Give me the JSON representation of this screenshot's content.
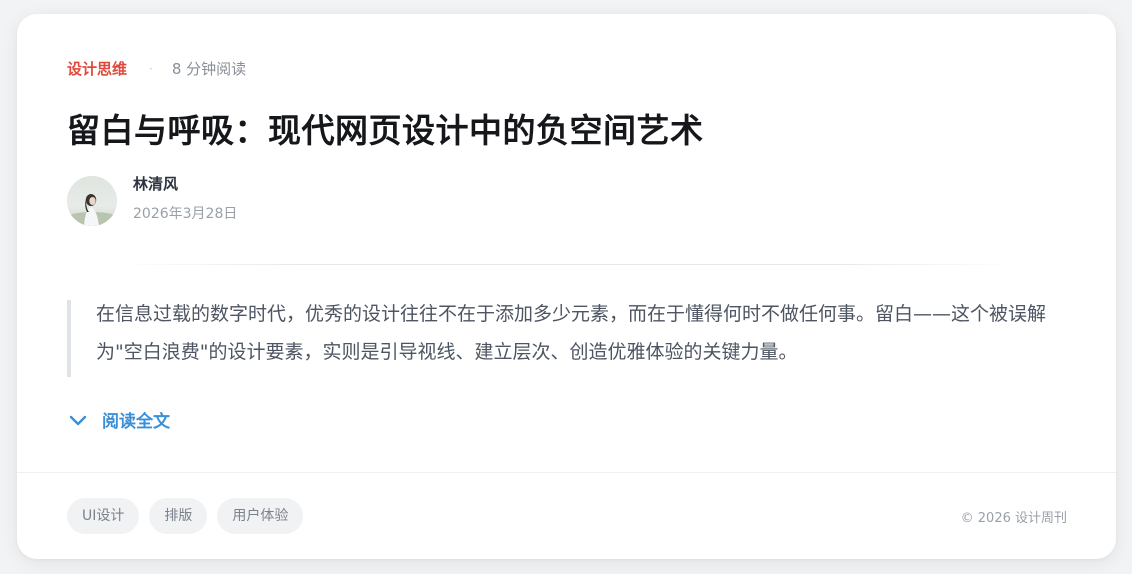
{
  "article": {
    "category": "设计思维",
    "separator": "·",
    "read_time": "8 分钟阅读",
    "title": "留白与呼吸：现代网页设计中的负空间艺术",
    "author": {
      "name": "林清风",
      "date": "2026年3月28日",
      "avatar_icon": "avatar-photo"
    },
    "excerpt": "在信息过载的数字时代，优秀的设计往往不在于添加多少元素，而在于懂得何时不做任何事。留白——这个被误解为\"空白浪费\"的设计要素，实则是引导视线、建立层次、创造优雅体验的关键力量。",
    "read_more": {
      "label": "阅读全文",
      "icon": "chevron-down-icon"
    }
  },
  "footer": {
    "tags": [
      "UI设计",
      "排版",
      "用户体验"
    ],
    "copyright": "© 2026 设计周刊"
  },
  "colors": {
    "accent_red": "#e14a3b",
    "link_blue": "#3b8fd8",
    "title": "#15171a",
    "muted": "#8a9099"
  }
}
